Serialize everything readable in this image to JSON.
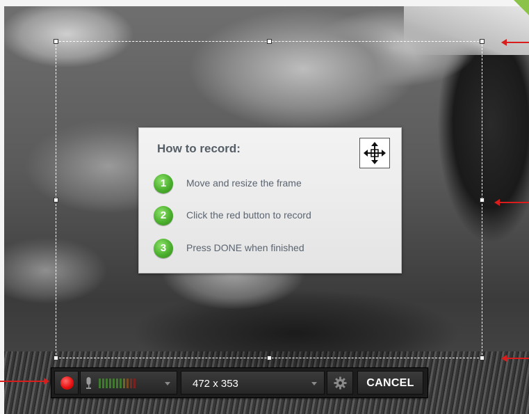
{
  "instructions": {
    "title": "How to record:",
    "steps": [
      {
        "number": "1",
        "text": "Move and resize the frame"
      },
      {
        "number": "2",
        "text": "Click the red button to record"
      },
      {
        "number": "3",
        "text": "Press DONE when finished"
      }
    ],
    "move_icon": "move-arrows-icon"
  },
  "toolbar": {
    "record_icon": "record-icon",
    "mic_icon": "microphone-icon",
    "audio_level_bars": 11,
    "audio_level_colors": [
      "#3f7a2e",
      "#3f7a2e",
      "#3f7a2e",
      "#3f7a2e",
      "#3f7a2e",
      "#3f7a2e",
      "#3f7a2e",
      "#6a6a24",
      "#7a4a20",
      "#7a2b1f",
      "#7a221f"
    ],
    "size_value": "472 x 353",
    "settings_icon": "gear-icon",
    "cancel_label": "CANCEL"
  },
  "colors": {
    "annotation_arrow": "#d91c1c",
    "record_red": "#e81313",
    "step_green": "#4caf2e"
  }
}
